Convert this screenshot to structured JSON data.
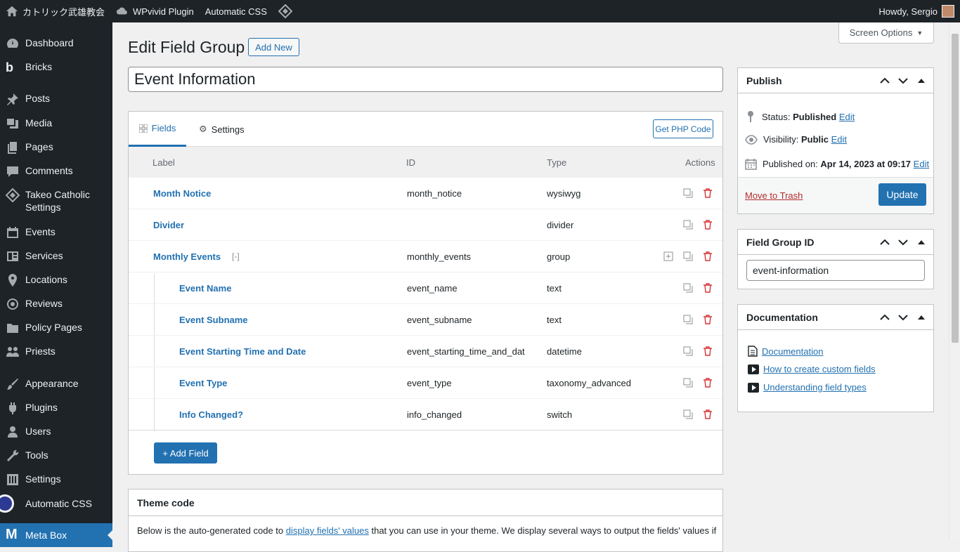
{
  "adminbar": {
    "site_name": "カトリック武雄教会",
    "wpvivid": "WPvivid Plugin",
    "automatic_css": "Automatic CSS",
    "howdy": "Howdy, Sergio"
  },
  "sidebar": {
    "items": [
      {
        "label": "Dashboard"
      },
      {
        "label": "Bricks"
      },
      {
        "label": "Posts"
      },
      {
        "label": "Media"
      },
      {
        "label": "Pages"
      },
      {
        "label": "Comments"
      },
      {
        "label": "Takeo Catholic Settings"
      },
      {
        "label": "Events"
      },
      {
        "label": "Services"
      },
      {
        "label": "Locations"
      },
      {
        "label": "Reviews"
      },
      {
        "label": "Policy Pages"
      },
      {
        "label": "Priests"
      },
      {
        "label": "Appearance"
      },
      {
        "label": "Plugins"
      },
      {
        "label": "Users"
      },
      {
        "label": "Tools"
      },
      {
        "label": "Settings"
      },
      {
        "label": "Automatic CSS"
      },
      {
        "label": "Meta Box"
      }
    ]
  },
  "screen_options": "Screen Options",
  "page": {
    "title": "Edit Field Group",
    "add_new": "Add New",
    "group_title": "Event Information"
  },
  "tabs": {
    "fields": "Fields",
    "settings": "Settings",
    "get_php": "Get PHP Code"
  },
  "table": {
    "headers": {
      "label": "Label",
      "id": "ID",
      "type": "Type",
      "actions": "Actions"
    },
    "rows": [
      {
        "label": "Month Notice",
        "id": "month_notice",
        "type": "wysiwyg"
      },
      {
        "label": "Divider",
        "id": "",
        "type": "divider"
      },
      {
        "label": "Monthly Events",
        "toggle": "[-]",
        "id": "monthly_events",
        "type": "group"
      },
      {
        "label": "Event Name",
        "id": "event_name",
        "type": "text"
      },
      {
        "label": "Event Subname",
        "id": "event_subname",
        "type": "text"
      },
      {
        "label": "Event Starting Time and Date",
        "id": "event_starting_time_and_dat",
        "type": "datetime"
      },
      {
        "label": "Event Type",
        "id": "event_type",
        "type": "taxonomy_advanced"
      },
      {
        "label": "Info Changed?",
        "id": "info_changed",
        "type": "switch"
      }
    ],
    "add_field": "+ Add Field"
  },
  "theme_code": {
    "title": "Theme code",
    "desc_before": "Below is the auto-generated code to ",
    "desc_link": "display fields' values",
    "desc_after": " that you can use in your theme. We display several ways to output the fields' values if"
  },
  "publish": {
    "title": "Publish",
    "status_label": "Status: ",
    "status_value": "Published",
    "visibility_label": "Visibility: ",
    "visibility_value": "Public",
    "published_label": "Published on: ",
    "published_value": "Apr 14, 2023 at 09:17",
    "edit": "Edit",
    "trash": "Move to Trash",
    "update": "Update"
  },
  "field_group_id": {
    "title": "Field Group ID",
    "value": "event-information"
  },
  "documentation": {
    "title": "Documentation",
    "links": [
      "Documentation",
      "How to create custom fields",
      "Understanding field types"
    ]
  }
}
